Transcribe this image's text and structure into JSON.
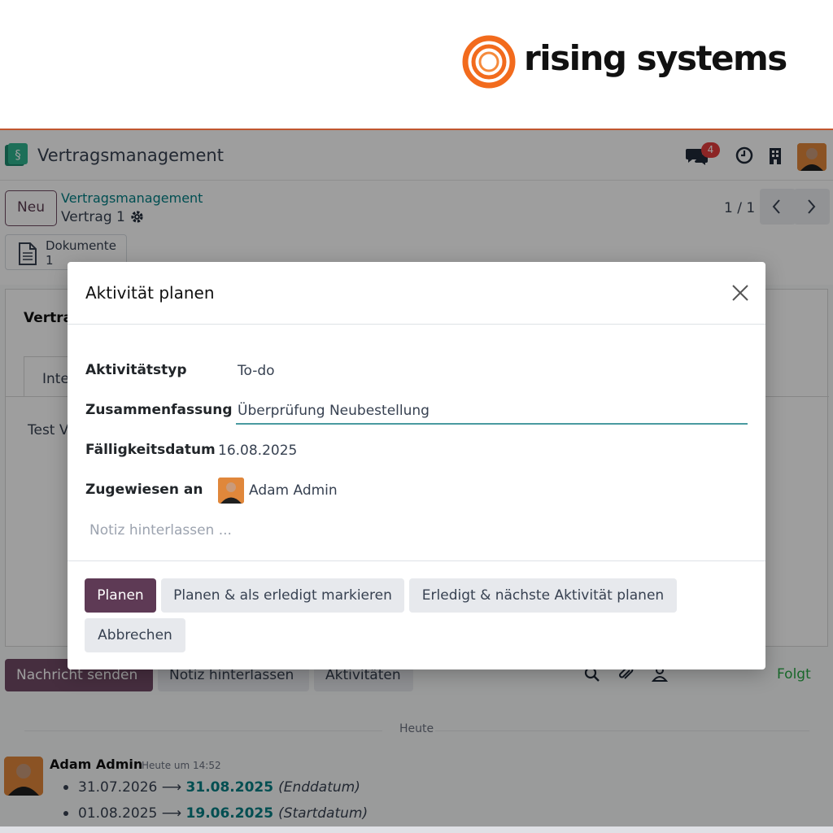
{
  "brand": {
    "name": "rising systems",
    "logo_color": "#f26b1d"
  },
  "navbar": {
    "app_title": "Vertragsmanagement",
    "chat_badge": "4",
    "icons": [
      "contract-book-icon",
      "chat-icon",
      "clock-icon",
      "building-icon",
      "user-avatar"
    ]
  },
  "control": {
    "new_label": "Neu",
    "breadcrumb_parent": "Vertragsmanagement",
    "breadcrumb_current": "Vertrag 1",
    "pager": "1 / 1",
    "smart_button": {
      "label": "Dokumente",
      "count": "1"
    }
  },
  "sheet": {
    "title_partial": "Vertra",
    "tab_partial": "Inte",
    "text_partial": "Test V"
  },
  "chatter": {
    "send_label": "Nachricht senden",
    "note_label": "Notiz hinterlassen",
    "activities_label": "Aktivitäten",
    "follow_label": "Folgt",
    "day_separator": "Heute",
    "message": {
      "author": "Adam Admin",
      "time": "Heute um 14:52",
      "changes": [
        {
          "old": "31.07.2026",
          "new": "31.08.2025",
          "field": "(Enddatum)"
        },
        {
          "old": "01.08.2025",
          "new": "19.06.2025",
          "field": "(Startdatum)"
        }
      ]
    }
  },
  "modal": {
    "title": "Aktivität planen",
    "fields": {
      "type_label": "Aktivitätstyp",
      "type_value": "To-do",
      "summary_label": "Zusammenfassung",
      "summary_value": "Überprüfung Neubestellung",
      "date_label": "Fälligkeitsdatum",
      "date_value": "16.08.2025",
      "assign_label": "Zugewiesen an",
      "assign_value": "Adam Admin",
      "note_placeholder": "Notiz hinterlassen ..."
    },
    "buttons": {
      "plan": "Planen",
      "plan_done": "Planen & als erledigt markieren",
      "done_next": "Erledigt & nächste Aktivität planen",
      "cancel": "Abbrechen"
    }
  },
  "colors": {
    "primary": "#714b67",
    "accent_teal": "#017e84",
    "follow_green": "#28a745",
    "badge_red": "#e23d3d"
  }
}
